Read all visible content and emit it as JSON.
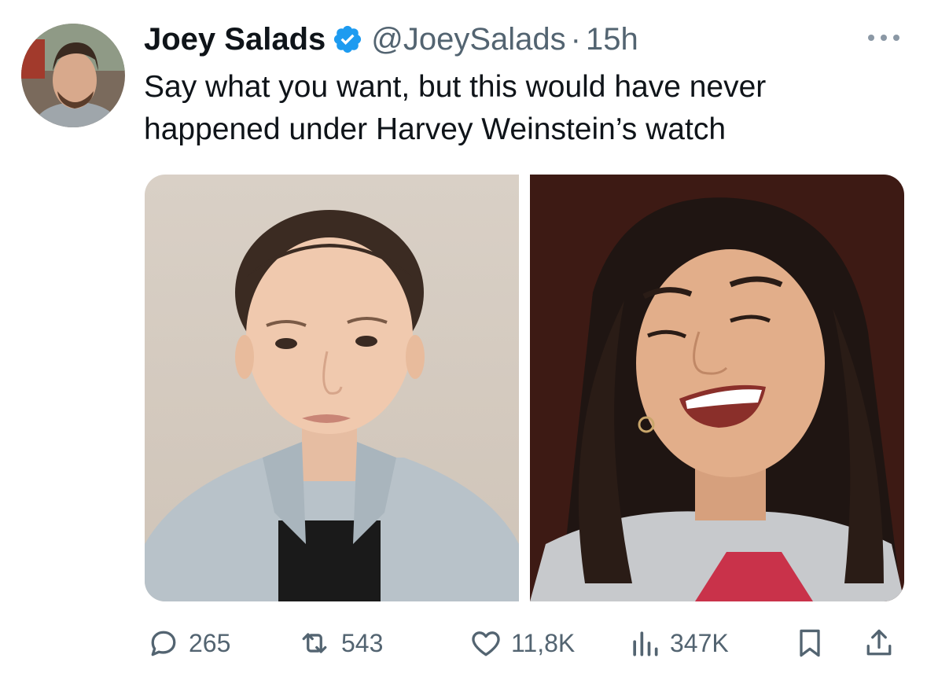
{
  "author": {
    "name": "Joey Salads",
    "handle": "@JoeySalads",
    "separator": "·",
    "timestamp": "15h",
    "verified": true
  },
  "tweet": {
    "text": "Say what you want, but this would have never happened under Harvey Weinstein’s watch"
  },
  "media": {
    "photos": [
      {
        "description": "portrait-photo-left"
      },
      {
        "description": "portrait-photo-right"
      }
    ]
  },
  "actions": {
    "replies": "265",
    "retweets": "543",
    "likes": "11,8K",
    "views": "347K"
  },
  "colors": {
    "text": "#0f1419",
    "secondary": "#536471",
    "verified_blue": "#1d9bf0"
  },
  "icons": [
    "verified-badge-icon",
    "more-icon",
    "reply-icon",
    "retweet-icon",
    "like-icon",
    "views-icon",
    "bookmark-icon",
    "share-icon"
  ]
}
